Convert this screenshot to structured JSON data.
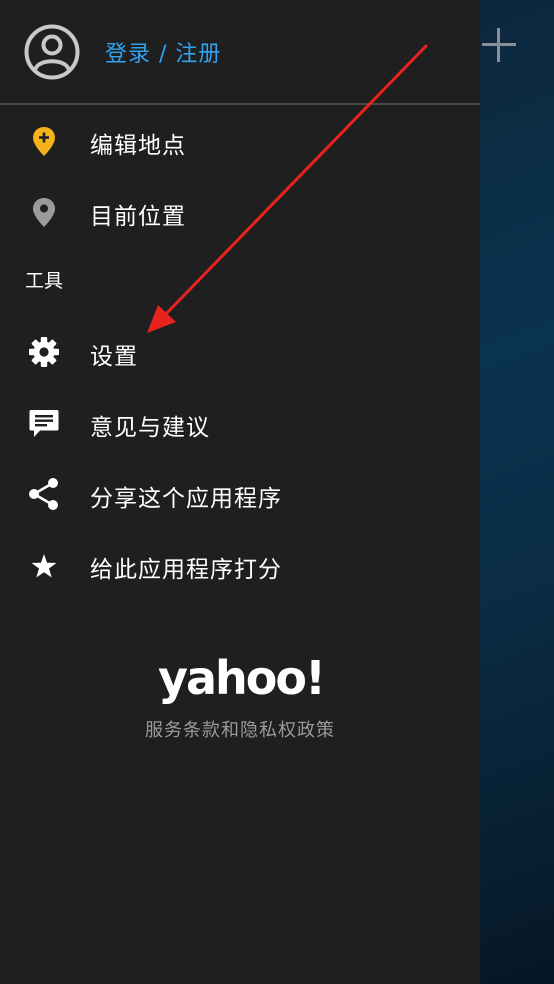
{
  "header": {
    "login_label": "登录 / 注册"
  },
  "menu": {
    "items": [
      {
        "label": "编辑地点",
        "icon": "location-pin-add-icon"
      },
      {
        "label": "目前位置",
        "icon": "location-pin-icon"
      }
    ],
    "tools_section_label": "工具",
    "tools": [
      {
        "label": "设置",
        "icon": "gear-icon"
      },
      {
        "label": "意见与建议",
        "icon": "feedback-icon"
      },
      {
        "label": "分享这个应用程序",
        "icon": "share-icon"
      },
      {
        "label": "给此应用程序打分",
        "icon": "star-icon"
      }
    ]
  },
  "footer": {
    "brand": "yahoo!",
    "terms_label": "服务条款和隐私权政策"
  },
  "colors": {
    "accent_blue": "#2ea3f2",
    "pin_yellow": "#f5b21b",
    "annotation_red": "#e8221e",
    "drawer_bg": "#1f1f1f"
  }
}
